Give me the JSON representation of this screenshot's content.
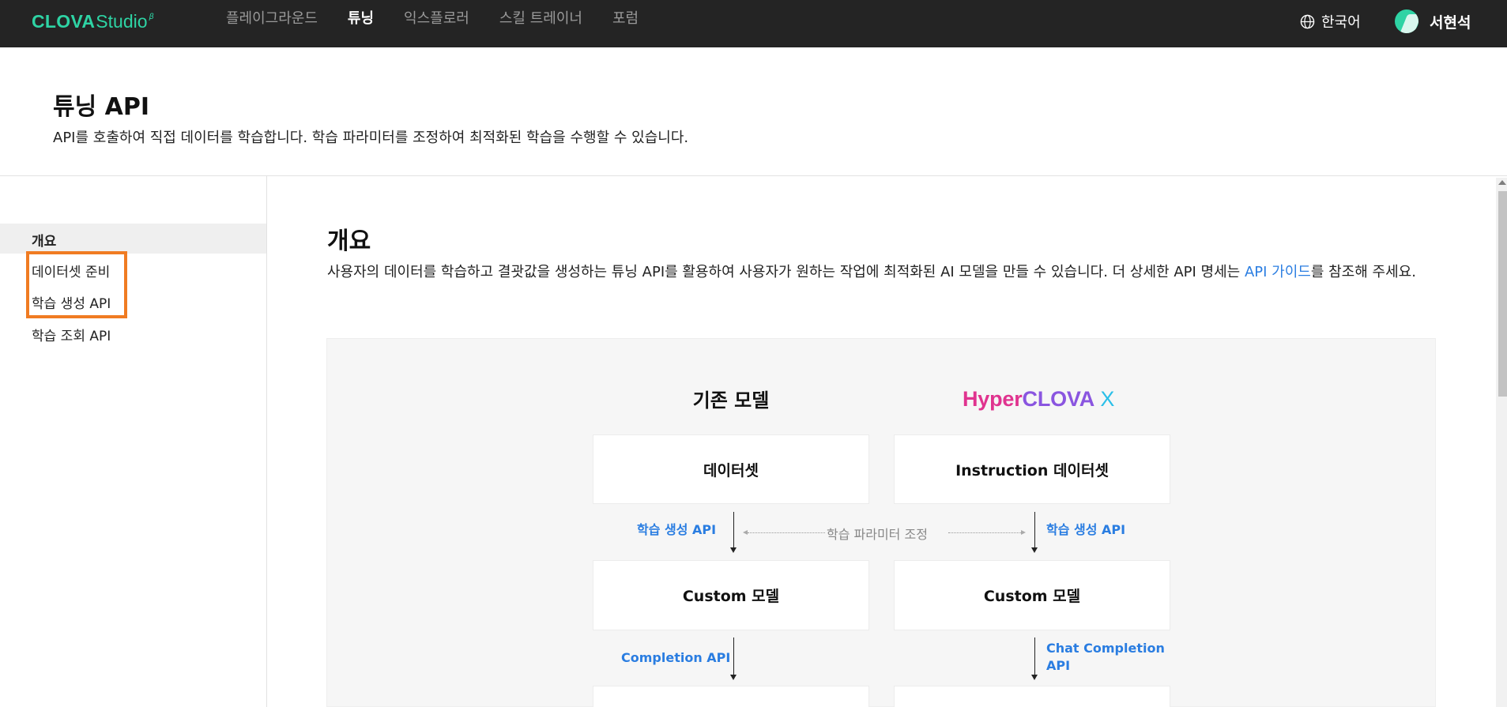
{
  "topbar": {
    "logo_main": "CLOVA",
    "logo_sub": "Studio",
    "logo_beta": "β",
    "nav": [
      {
        "label": "플레이그라운드",
        "active": false
      },
      {
        "label": "튜닝",
        "active": true
      },
      {
        "label": "익스플로러",
        "active": false
      },
      {
        "label": "스킬 트레이너",
        "active": false
      },
      {
        "label": "포럼",
        "active": false
      }
    ],
    "language": "한국어",
    "user_name": "서현석"
  },
  "header": {
    "title": "튜닝 API",
    "description": "API를 호출하여 직접 데이터를 학습합니다. 학습 파라미터를 조정하여 최적화된 학습을 수행할 수 있습니다."
  },
  "sidebar": {
    "items": [
      {
        "label": "개요",
        "active": true
      },
      {
        "label": "데이터셋 준비",
        "active": false
      },
      {
        "label": "학습 생성 API",
        "active": false
      },
      {
        "label": "학습 조회 API",
        "active": false
      }
    ]
  },
  "main": {
    "section_title": "개요",
    "desc_before": "사용자의 데이터를 학습하고 결괏값을 생성하는 튜닝 API를 활용하여 사용자가 원하는 작업에 최적화된 AI 모델을 만들 수 있습니다. 더 상세한 API 명세는 ",
    "desc_link": "API 가이드",
    "desc_after": "를 참조해 주세요."
  },
  "diagram": {
    "left_title": "기존 모델",
    "right_title_parts": [
      "Hyper",
      "CLOVA",
      " X"
    ],
    "left_dataset": "데이터셋",
    "right_dataset": "Instruction 데이터셋",
    "train_api_left": "학습 생성 API",
    "train_api_right": "학습 생성 API",
    "param_label": "학습 파라미터 조정",
    "left_custom": "Custom 모델",
    "right_custom": "Custom 모델",
    "completion_api": "Completion API",
    "chat_completion_api_line1": "Chat Completion",
    "chat_completion_api_line2": "API"
  },
  "colors": {
    "accent_green": "#2ed3a4",
    "link_blue": "#2a7de1",
    "highlight_orange": "#f07b22",
    "topbar_bg": "#242424"
  },
  "icons": {
    "language": "globe-icon",
    "user": "avatar"
  }
}
